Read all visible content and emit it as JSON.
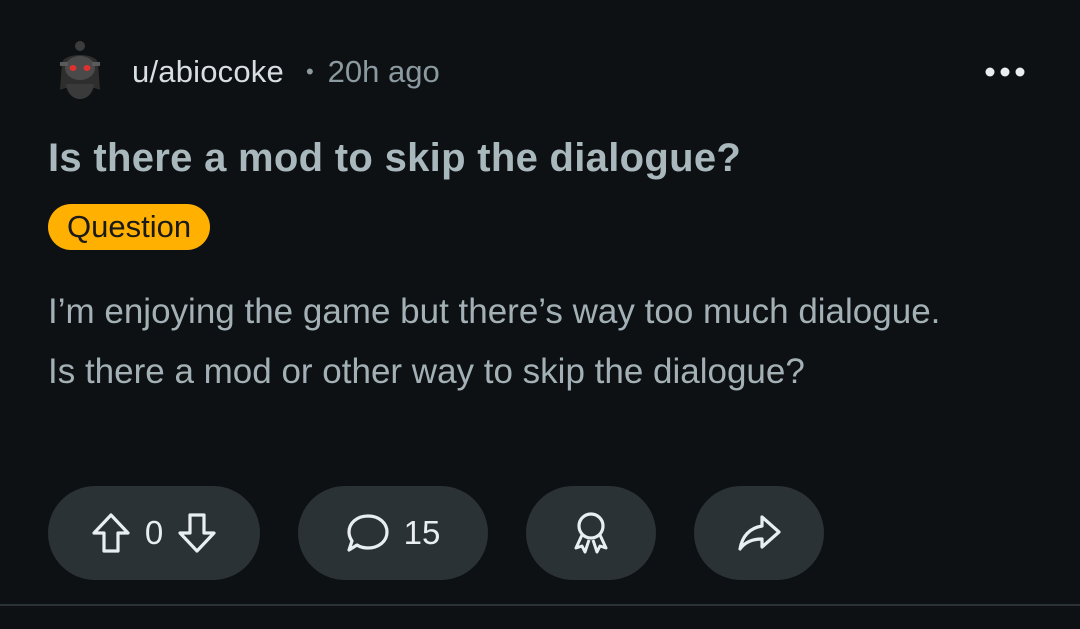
{
  "post": {
    "author": "u/abiocoke",
    "separator": "•",
    "time": "20h ago",
    "title": "Is there a mod to skip the dialogue?",
    "flair": "Question",
    "body": "I’m enjoying the game but there’s way too much dialogue. Is there a mod or other way to skip the dialogue?",
    "flair_color": "#ffb000"
  },
  "actions": {
    "vote_count": "0",
    "comment_count": "15"
  },
  "icons": {
    "more": "more-horizontal-icon",
    "upvote": "upvote-arrow-icon",
    "downvote": "downvote-arrow-icon",
    "comment": "comment-bubble-icon",
    "award": "award-icon",
    "share": "share-arrow-icon"
  }
}
